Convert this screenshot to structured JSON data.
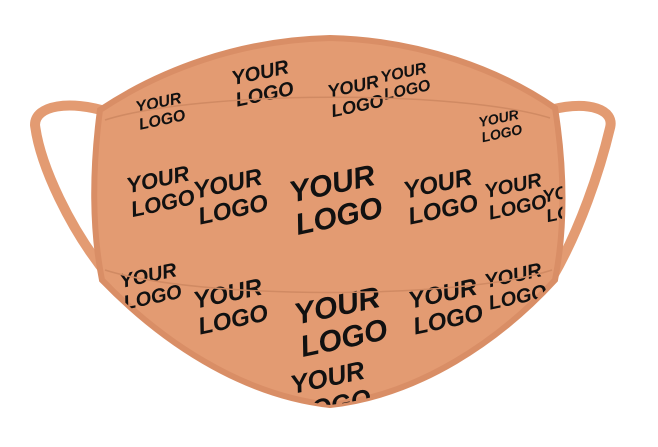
{
  "product": {
    "logo_line1": "YOUR",
    "logo_line2": "LOGO"
  },
  "colors": {
    "mask": "#e39b72",
    "mask_edge": "#d98e66",
    "strap": "#e39b72",
    "ink": "#111111"
  }
}
